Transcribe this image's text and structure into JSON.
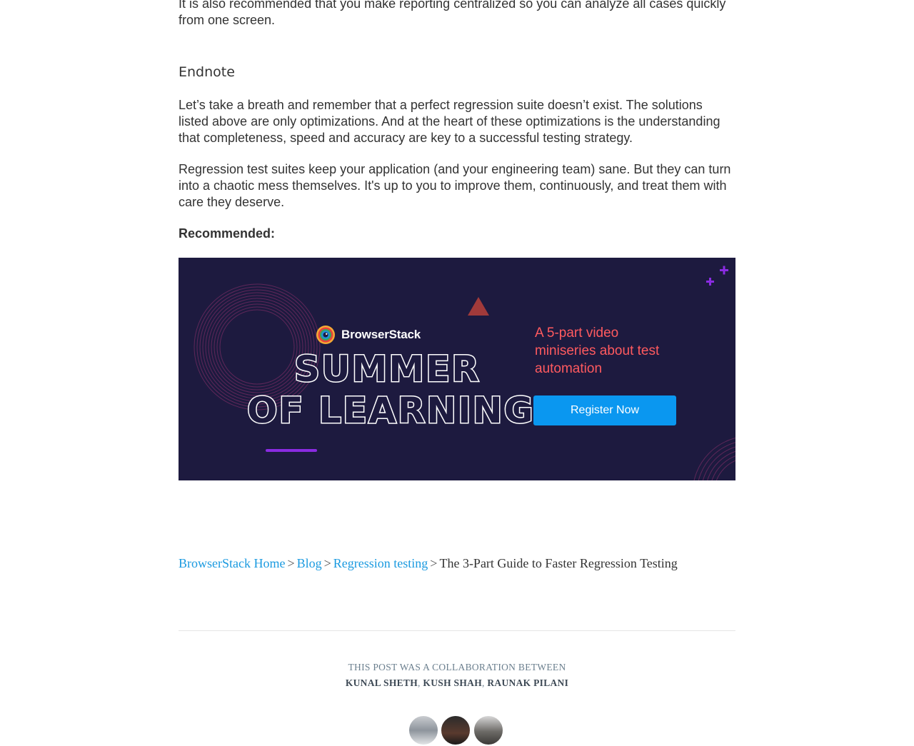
{
  "article": {
    "intro_tail": "It is also recommended that you make reporting centralized so you can analyze all cases quickly from one screen.",
    "endnote_heading": "Endnote",
    "endnote_paragraphs": [
      "Let’s take a breath and remember that a perfect regression suite doesn’t exist. The solutions listed above are only optimizations. And at the heart of these optimizations is the understanding that completeness, speed and accuracy are key to a successful testing strategy.",
      "Regression test suites keep your application (and your engineering team) sane. But they can turn into a chaotic mess themselves. It's up to you to improve them, continuously, and treat them with care they deserve."
    ],
    "recommended_label": "Recommended:"
  },
  "banner": {
    "brand": "BrowserStack",
    "title_line1": "SUMMER",
    "title_line2": "OF LEARNING",
    "tagline": "A 5-part video miniseries about test automation",
    "cta_label": "Register Now",
    "colors": {
      "background": "#1d1a3f",
      "tagline": "#ff5a5f",
      "cta": "#0a97f0",
      "accent_purple": "#8a2be2"
    }
  },
  "breadcrumb": {
    "items": [
      {
        "label": "BrowserStack Home",
        "link": true
      },
      {
        "label": "Blog",
        "link": true
      },
      {
        "label": "Regression testing",
        "link": true
      },
      {
        "label": "The 3-Part Guide to Faster Regression Testing",
        "link": false
      }
    ],
    "separator": ">"
  },
  "collaboration": {
    "heading": "THIS POST WAS A COLLABORATION BETWEEN",
    "authors": [
      "KUNAL SHETH",
      "KUSH SHAH",
      "RAUNAK PILANI"
    ],
    "author_separator": ","
  },
  "avatars": {
    "icons": [
      "author-avatar",
      "author-avatar",
      "author-avatar"
    ]
  }
}
